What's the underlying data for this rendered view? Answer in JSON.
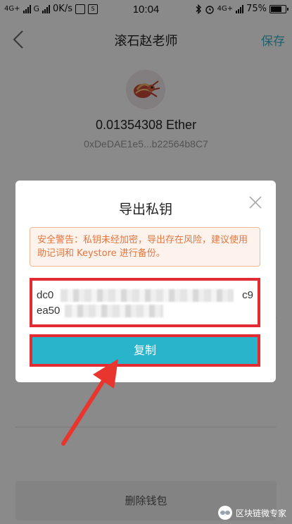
{
  "status_bar": {
    "net_left": "4G+",
    "net_mid": "G",
    "speed": "0K/s",
    "time": "10:04",
    "net_right": "4G+",
    "battery": "75%"
  },
  "nav": {
    "back_icon": "chevron-left-icon",
    "title": "滚石赵老师",
    "save_label": "保存"
  },
  "wallet": {
    "avatar_icon": "hermit-crab-avatar",
    "balance": "0.01354308 Ether",
    "address": "0xDeDAE1e5...b22564b8C7"
  },
  "dialog": {
    "title": "导出私钥",
    "close_icon": "close-icon",
    "warning": "安全警告：私钥未经加密，导出存在风险，建议使用助记词和 Keystore 进行备份。",
    "key_line1_start": "dc0",
    "key_line1_end": "c9",
    "key_line2_start": "ea50",
    "copy_label": "复制"
  },
  "footer": {
    "delete_label": "删除钱包"
  },
  "watermark": {
    "text": "区块链微专家"
  },
  "colors": {
    "accent": "#29b4cc",
    "highlight": "#e32b33",
    "warning_text": "#e2763e"
  }
}
